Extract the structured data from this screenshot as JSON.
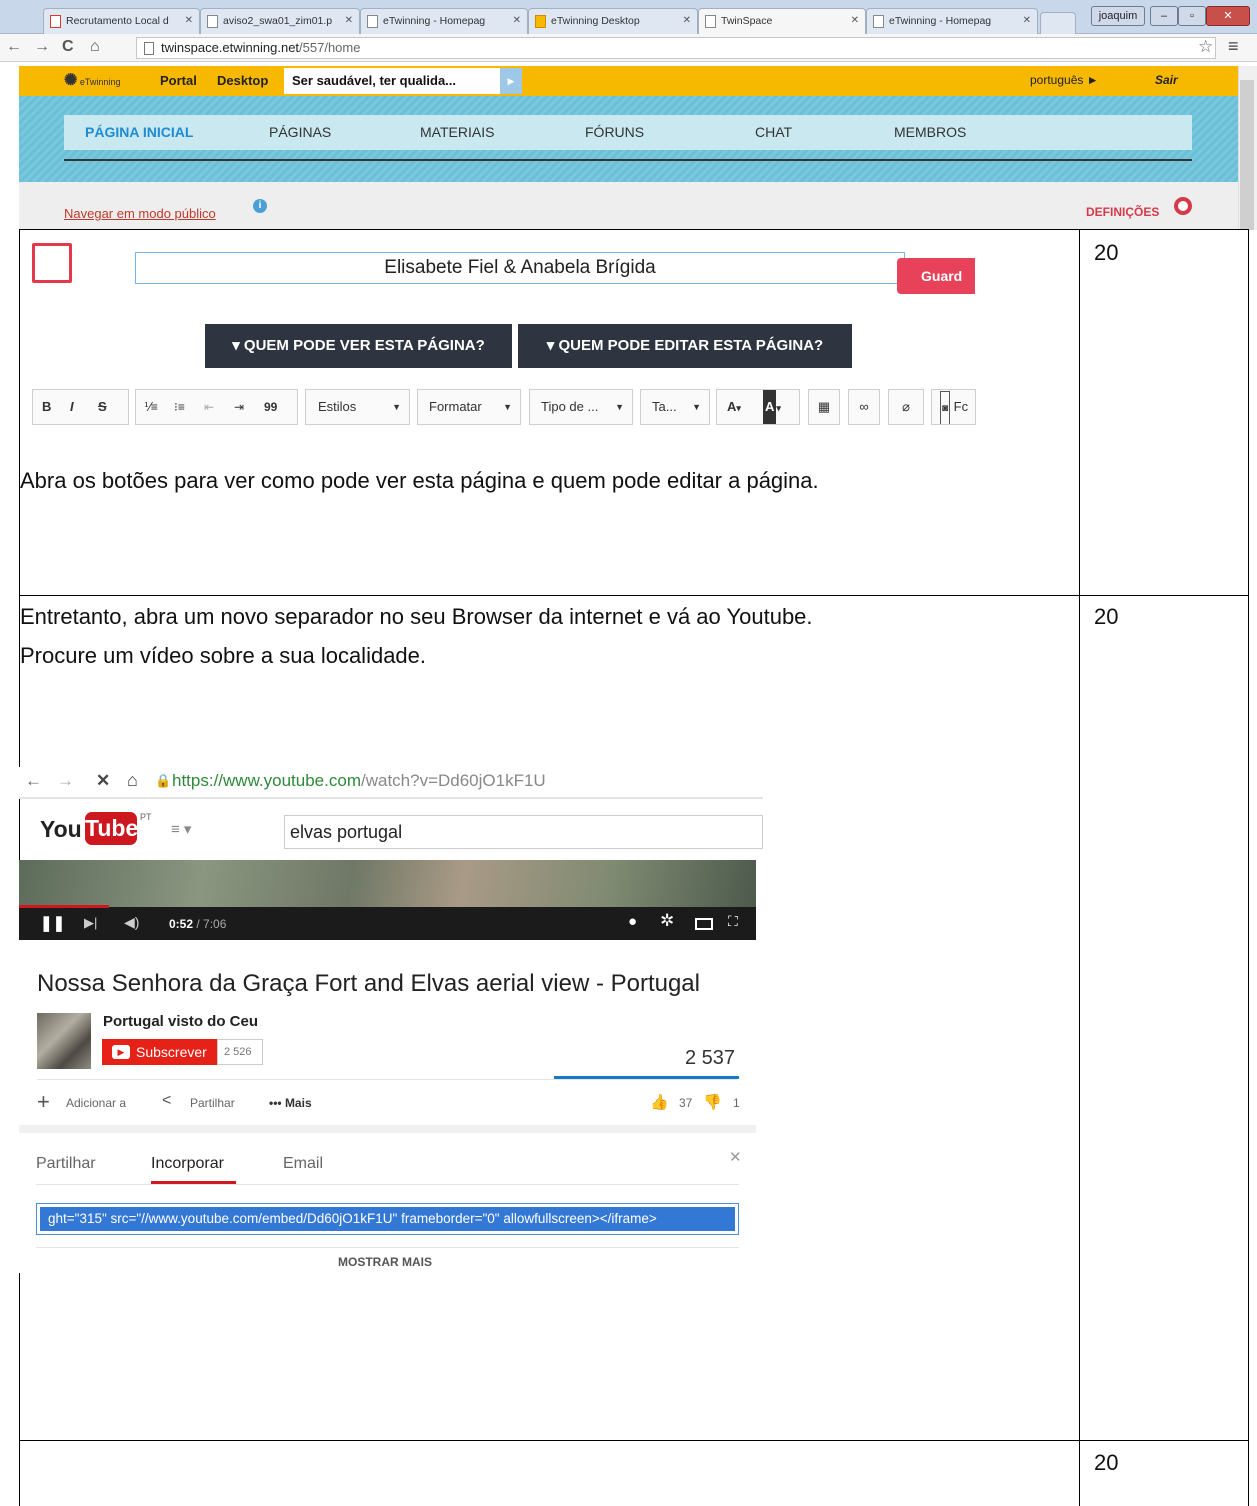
{
  "browser": {
    "tabs": [
      {
        "label": "Recrutamento Local d",
        "active": false
      },
      {
        "label": "aviso2_swa01_zim01.p",
        "active": false
      },
      {
        "label": "eTwinning - Homepag",
        "active": false
      },
      {
        "label": "eTwinning Desktop",
        "active": false
      },
      {
        "label": "TwinSpace",
        "active": true
      },
      {
        "label": "eTwinning - Homepag",
        "active": false
      }
    ],
    "user_badge": "joaquim",
    "url_host": "twinspace.etwinning.net",
    "url_path": "/557/home"
  },
  "etwinning": {
    "logo": "eTwinning",
    "portal": "Portal",
    "desktop": "Desktop",
    "search_value": "Ser saudável, ter qualida...",
    "language": "português ►",
    "logout": "Sair",
    "nav": [
      "PÁGINA INICIAL",
      "PÁGINAS",
      "MATERIAIS",
      "FÓRUNS",
      "CHAT",
      "MEMBROS"
    ],
    "public_mode": "Navegar em modo público",
    "settings": "DEFINIÇÕES"
  },
  "editor": {
    "title_value": "Elisabete Fiel  & Anabela Brígida",
    "save": "Guard",
    "who_can_view": "▾ QUEM PODE VER ESTA PÁGINA?",
    "who_can_edit": "▾ QUEM PODE EDITAR ESTA PÁGINA?",
    "bold": "B",
    "italic": "I",
    "strike": "S",
    "quote": "99",
    "styles": "Estilos",
    "format": "Formatar",
    "font_type": "Tipo de ...",
    "size": "Ta...",
    "font_color": "A",
    "bg_color": "A",
    "last": "Fc"
  },
  "rows": [
    {
      "number": "20",
      "text1": "Abra os botões para ver como pode ver esta página e quem pode editar a página."
    },
    {
      "number": "20",
      "text1": "Entretanto, abra um novo separador no seu Browser da internet e vá ao Youtube.",
      "text2": "Procure um vídeo sobre a sua localidade."
    },
    {
      "number": "20"
    }
  ],
  "youtube": {
    "url_secure": "https://www.youtube.com",
    "url_rest": "/watch?v=Dd60jO1kF1U",
    "logo_you": "You",
    "logo_tube": "Tube",
    "region": "PT",
    "search_value": "elvas portugal",
    "time_current": "0:52",
    "time_total": " / 7:06",
    "title": "Nossa Senhora da Graça Fort and Elvas aerial view - Portugal",
    "channel": "Portugal visto do Ceu",
    "subscribe": "Subscrever",
    "subscribers": "2 526",
    "views": "2 537",
    "add_to": "Adicionar a",
    "share": "Partilhar",
    "more": "Mais",
    "likes": "37",
    "dislikes": "1",
    "tab_share": "Partilhar",
    "tab_embed": "Incorporar",
    "tab_email": "Email",
    "embed_code": "ght=\"315\" src=\"//www.youtube.com/embed/Dd60jO1kF1U\" frameborder=\"0\" allowfullscreen></iframe>",
    "show_more": "MOSTRAR MAIS"
  }
}
